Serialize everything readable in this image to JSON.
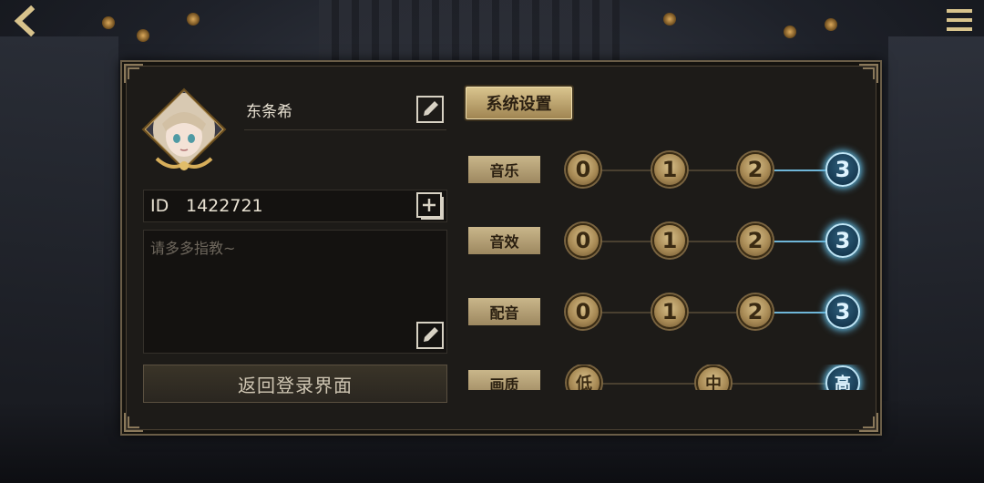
{
  "nav": {
    "back_icon": "chevron-left-icon",
    "menu_icon": "hamburger-menu-icon"
  },
  "profile": {
    "username": "东条希",
    "id_label": "ID",
    "id_value": "1422721",
    "bio_placeholder": "请多多指教~",
    "return_label": "返回登录界面",
    "edit_icon": "edit-pencil-icon",
    "add_icon": "add-square-icon"
  },
  "settings": {
    "tab_label": "系统设置",
    "rows": [
      {
        "label": "音乐",
        "options": [
          "0",
          "1",
          "2",
          "3"
        ],
        "selected": 3
      },
      {
        "label": "音效",
        "options": [
          "0",
          "1",
          "2",
          "3"
        ],
        "selected": 3
      },
      {
        "label": "配音",
        "options": [
          "0",
          "1",
          "2",
          "3"
        ],
        "selected": 3
      },
      {
        "label": "画质",
        "options": [
          "低",
          "中",
          "高"
        ],
        "selected": 2
      }
    ]
  },
  "colors": {
    "gold": "#c9b68a",
    "active_blue": "#6fb6d8",
    "panel_bg": "#1d1b18"
  }
}
